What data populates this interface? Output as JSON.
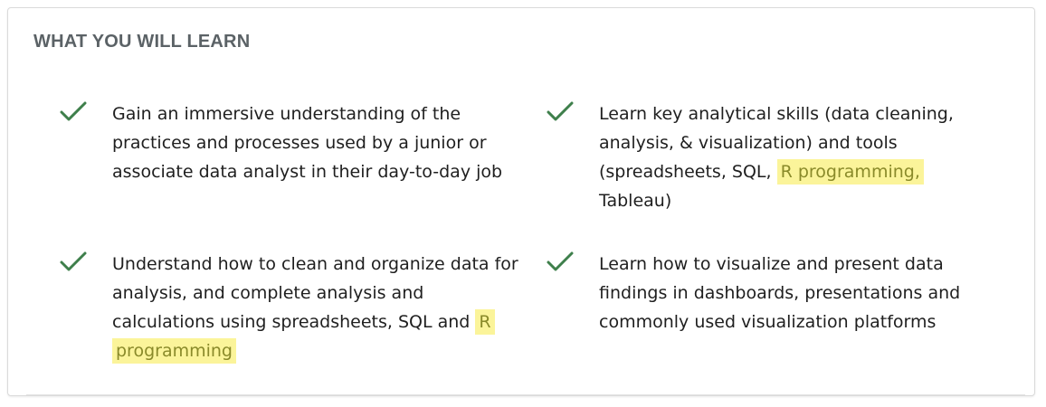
{
  "section": {
    "title": "WHAT YOU WILL LEARN"
  },
  "colors": {
    "check": "#3e7f4b",
    "highlight": "#fbf49a",
    "heading": "#5b6266"
  },
  "icons": {
    "bullet": "check-icon"
  },
  "items": [
    {
      "text": "Gain an immersive understanding of the practices and processes used by a junior or associate data analyst in their day-to-day job"
    },
    {
      "text_before": "Learn key analytical skills (data cleaning, analysis, & visualization) and tools (spreadsheets, SQL, ",
      "highlight": "R programming,",
      "text_after": " Tableau)"
    },
    {
      "text_before": "Understand how to clean and organize data for analysis, and complete analysis and calculations using spreadsheets, SQL and ",
      "highlight": "R programming",
      "text_after": ""
    },
    {
      "text": "Learn how to visualize and present data findings in dashboards, presentations and commonly used visualization platforms"
    }
  ]
}
